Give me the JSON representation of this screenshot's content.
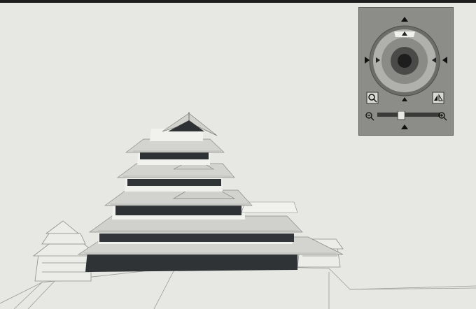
{
  "viewer": {
    "scene": "castle-3d-model",
    "navigation": {
      "zoom_level": 0.38
    }
  },
  "colors": {
    "background": "#e7e8e4",
    "widget_bg": "#8c8c88",
    "ring": "#b2b2ae",
    "dark": "#1e1e1e",
    "roof": "#cfcfcb",
    "wall_dark": "#2f3336",
    "wall_light": "#f2f2ee"
  }
}
